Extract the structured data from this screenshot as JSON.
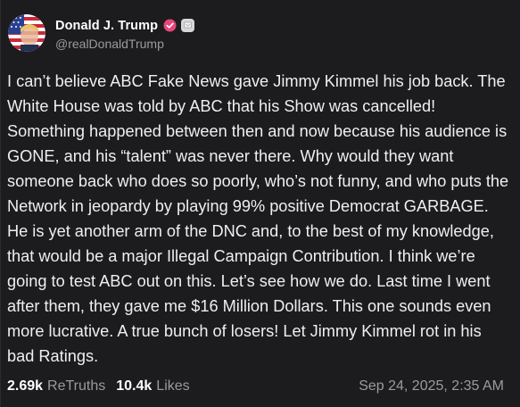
{
  "post": {
    "author": {
      "display_name": "Donald J. Trump",
      "handle": "@realDonaldTrump",
      "verified_icon": "verified-badge-icon",
      "accent_color": "#e8457a"
    },
    "text": "I can’t believe ABC Fake News gave Jimmy Kimmel his job back. The White House was told by ABC that his Show was cancelled! Something happened between then and now because his audience is GONE, and his “talent” was never there. Why would they want someone back who does so poorly, who’s not funny, and who puts the Network in jeopardy by playing 99% positive Democrat GARBAGE. He is yet another arm of the DNC and, to the best of my knowledge, that would be a major Illegal Campaign Contribution. I think we’re going to test ABC out on this. Let’s see how we do. Last time I went after them, they gave me $16 Million Dollars. This one sounds even more lucrative. A true bunch of losers! Let Jimmy Kimmel rot in his bad Ratings.",
    "stats": {
      "retruths_count": "2.69k",
      "retruths_label": "ReTruths",
      "likes_count": "10.4k",
      "likes_label": "Likes"
    },
    "timestamp": "Sep 24, 2025, 2:35 AM"
  }
}
